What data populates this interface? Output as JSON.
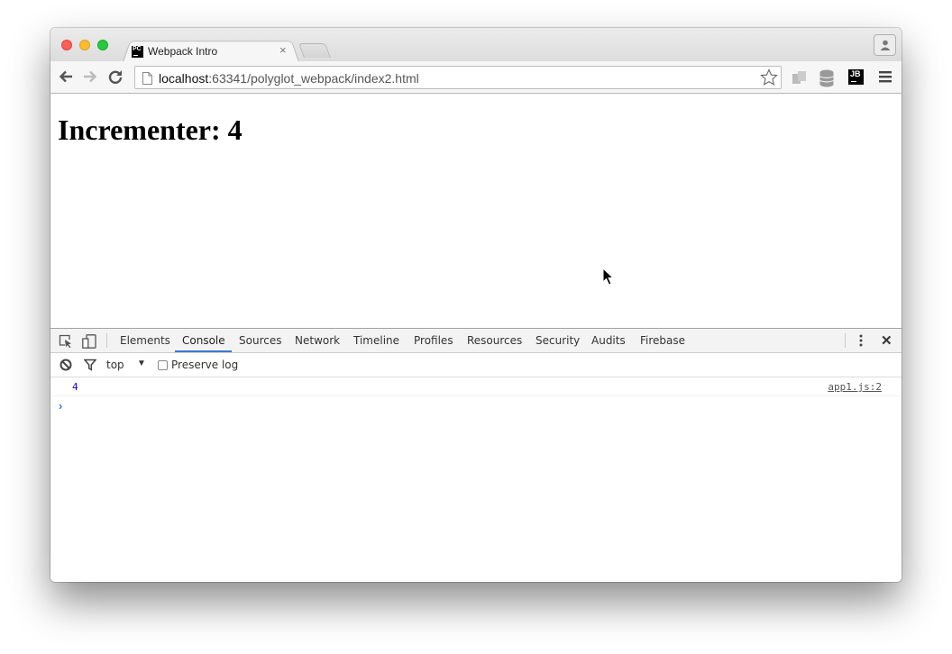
{
  "browser": {
    "tab_title": "Webpack Intro",
    "favicon_text": "PC",
    "tab_close": "×",
    "url_host": "localhost",
    "url_rest": ":63341/polyglot_webpack/index2.html",
    "extension_jb_text": "JB"
  },
  "page": {
    "heading": "Incrementer: 4"
  },
  "devtools": {
    "tabs": [
      "Elements",
      "Console",
      "Sources",
      "Network",
      "Timeline",
      "Profiles",
      "Resources",
      "Security",
      "Audits",
      "Firebase"
    ],
    "active_tab": "Console",
    "close_label": "✕",
    "console_toolbar": {
      "context": "top",
      "context_arrow": "▼",
      "preserve_log_label": "Preserve log",
      "preserve_log_checked": false
    },
    "messages": [
      {
        "value": "4",
        "source": "app1.js:2"
      }
    ],
    "prompt": "›",
    "accent": "#3879d9"
  }
}
